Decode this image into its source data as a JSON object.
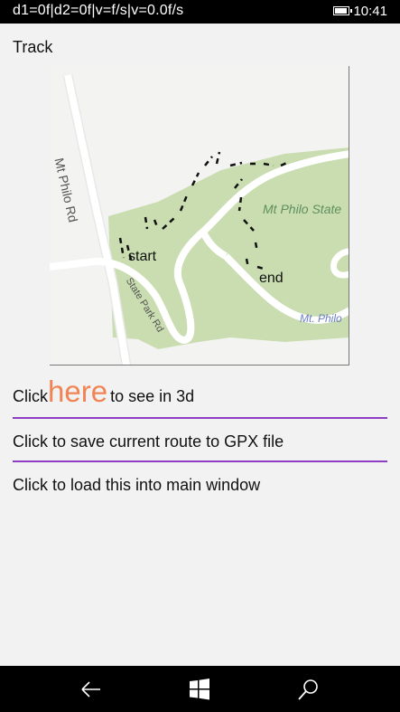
{
  "status": {
    "debug_text": "d1=0f|d2=0f|v=f/s|v=0.0f/s",
    "time": "10:41",
    "battery_level": 0.95
  },
  "page": {
    "title": "Track"
  },
  "map": {
    "road_main": "Mt Philo Rd",
    "road_park": "State Park Rd",
    "park_label_1": "Mt Philo State",
    "park_label_2": "Mt. Philo",
    "start_label": "start",
    "end_label": "end"
  },
  "actions": {
    "view3d_prefix": "Click",
    "view3d_link": "here",
    "view3d_suffix": "to see in 3d",
    "save_gpx": "Click to save current route to GPX file",
    "load_main": "Click to load this into main window"
  },
  "colors": {
    "accent": "#f08454",
    "divider": "#8e3dc4",
    "park_green": "#c9ddb0",
    "road": "#ffffff"
  },
  "nav": {
    "back_icon": "back-arrow-icon",
    "home_icon": "windows-logo-icon",
    "search_icon": "search-icon"
  }
}
